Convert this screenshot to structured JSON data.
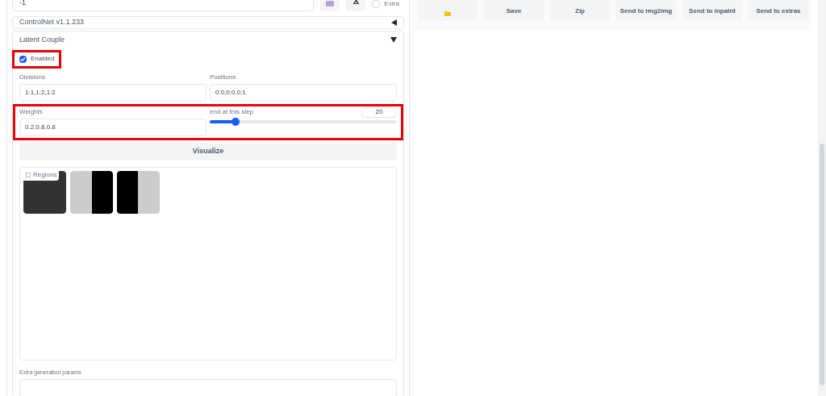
{
  "seed": {
    "value": "-1",
    "extra": {
      "label": "Extra",
      "checked": false
    }
  },
  "accordions": [
    {
      "title": "ControlNet v1.1.233",
      "expanded": false
    }
  ],
  "latent_couple": {
    "title": "Latent Couple",
    "expanded": true,
    "enabled": {
      "label": "Enabled",
      "checked": true,
      "highlighted": true
    },
    "divisions": {
      "label": "Divisions",
      "value": "1:1,1:2,1:2"
    },
    "positions": {
      "label": "Positions",
      "value": "0:0,0:0,0:1"
    },
    "weights_row": {
      "highlighted": true,
      "weights": {
        "label": "Weights",
        "value": "0.2,0.8,0.8"
      },
      "end_step": {
        "label": "end at this step",
        "value": "20",
        "level": 0.14
      }
    },
    "visualize": "Visualize",
    "regions": {
      "label": "Regions",
      "images": [
        {
          "kind": "full"
        },
        {
          "kind": "right"
        },
        {
          "kind": "left"
        }
      ]
    },
    "extra_params": {
      "label": "Extra generation params"
    }
  },
  "actions": [
    {
      "kind": "folder"
    },
    {
      "kind": "text",
      "label": "Save"
    },
    {
      "kind": "text",
      "label": "Zip"
    },
    {
      "kind": "text",
      "label": "Send to img2img"
    },
    {
      "kind": "text",
      "label": "Send to inpaint"
    },
    {
      "kind": "text",
      "label": "Send to extras"
    }
  ]
}
